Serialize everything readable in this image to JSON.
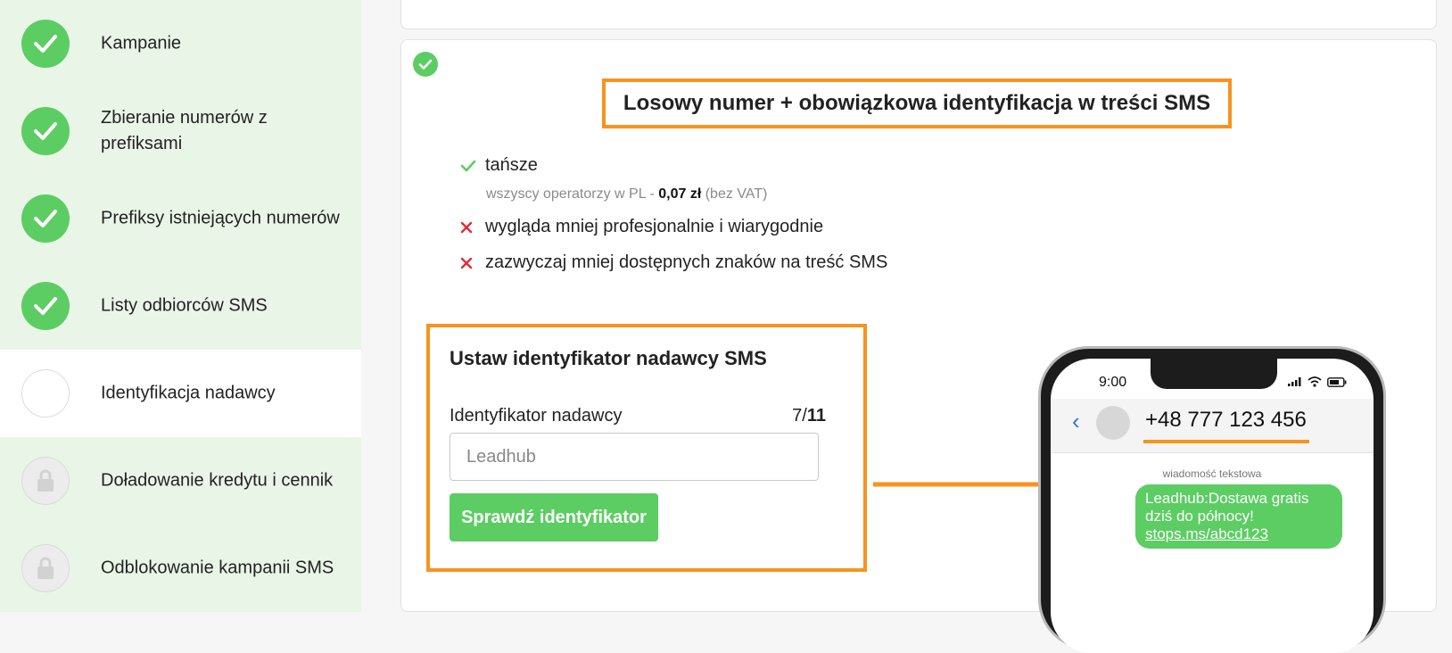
{
  "colors": {
    "accent": "#5ccd63",
    "highlight": "#f7931e",
    "error": "#e2293b",
    "done_bg": "#e9f6e7"
  },
  "sidebar": {
    "steps": [
      {
        "label": "Kampanie",
        "state": "done",
        "icon": "check-icon"
      },
      {
        "label": "Zbieranie numerów z prefiksami",
        "state": "done",
        "icon": "check-icon"
      },
      {
        "label": "Prefiksy istniejących numerów",
        "state": "done",
        "icon": "check-icon"
      },
      {
        "label": "Listy odbiorców SMS",
        "state": "done",
        "icon": "check-icon"
      },
      {
        "label": "Identyfikacja nadawcy",
        "state": "current",
        "icon": "empty-circle-icon"
      },
      {
        "label": "Doładowanie kredytu i cennik",
        "state": "locked",
        "icon": "lock-icon"
      },
      {
        "label": "Odblokowanie kampanii SMS",
        "state": "locked",
        "icon": "lock-icon"
      }
    ]
  },
  "option": {
    "headline": "Losowy numer + obowiązkowa identyfikacja w treści SMS",
    "pros": [
      {
        "text": "tańsze",
        "icon": "check-icon"
      }
    ],
    "price_note": {
      "prefix": "wszyscy operatorzy w PL - ",
      "price": "0,07 zł",
      "suffix": " (bez VAT)"
    },
    "cons": [
      {
        "text": "wygląda mniej profesjonalnie i wiarygodnie",
        "icon": "cross-icon"
      },
      {
        "text": "zazwyczaj mniej dostępnych znaków na treść SMS",
        "icon": "cross-icon"
      }
    ]
  },
  "form": {
    "title": "Ustaw identyfikator nadawcy SMS",
    "field_label": "Identyfikator nadawcy",
    "counter_current": "7/",
    "counter_max": "11",
    "input_value": "Leadhub",
    "button_label": "Sprawdź identyfikator"
  },
  "phone": {
    "time": "9:00",
    "number": "+48 777 123 456",
    "message_type": "wiadomość tekstowa",
    "message_lines": [
      "Leadhub:Dostawa gratis",
      "dziś do północy!"
    ],
    "message_link": "stops.ms/abcd123"
  }
}
